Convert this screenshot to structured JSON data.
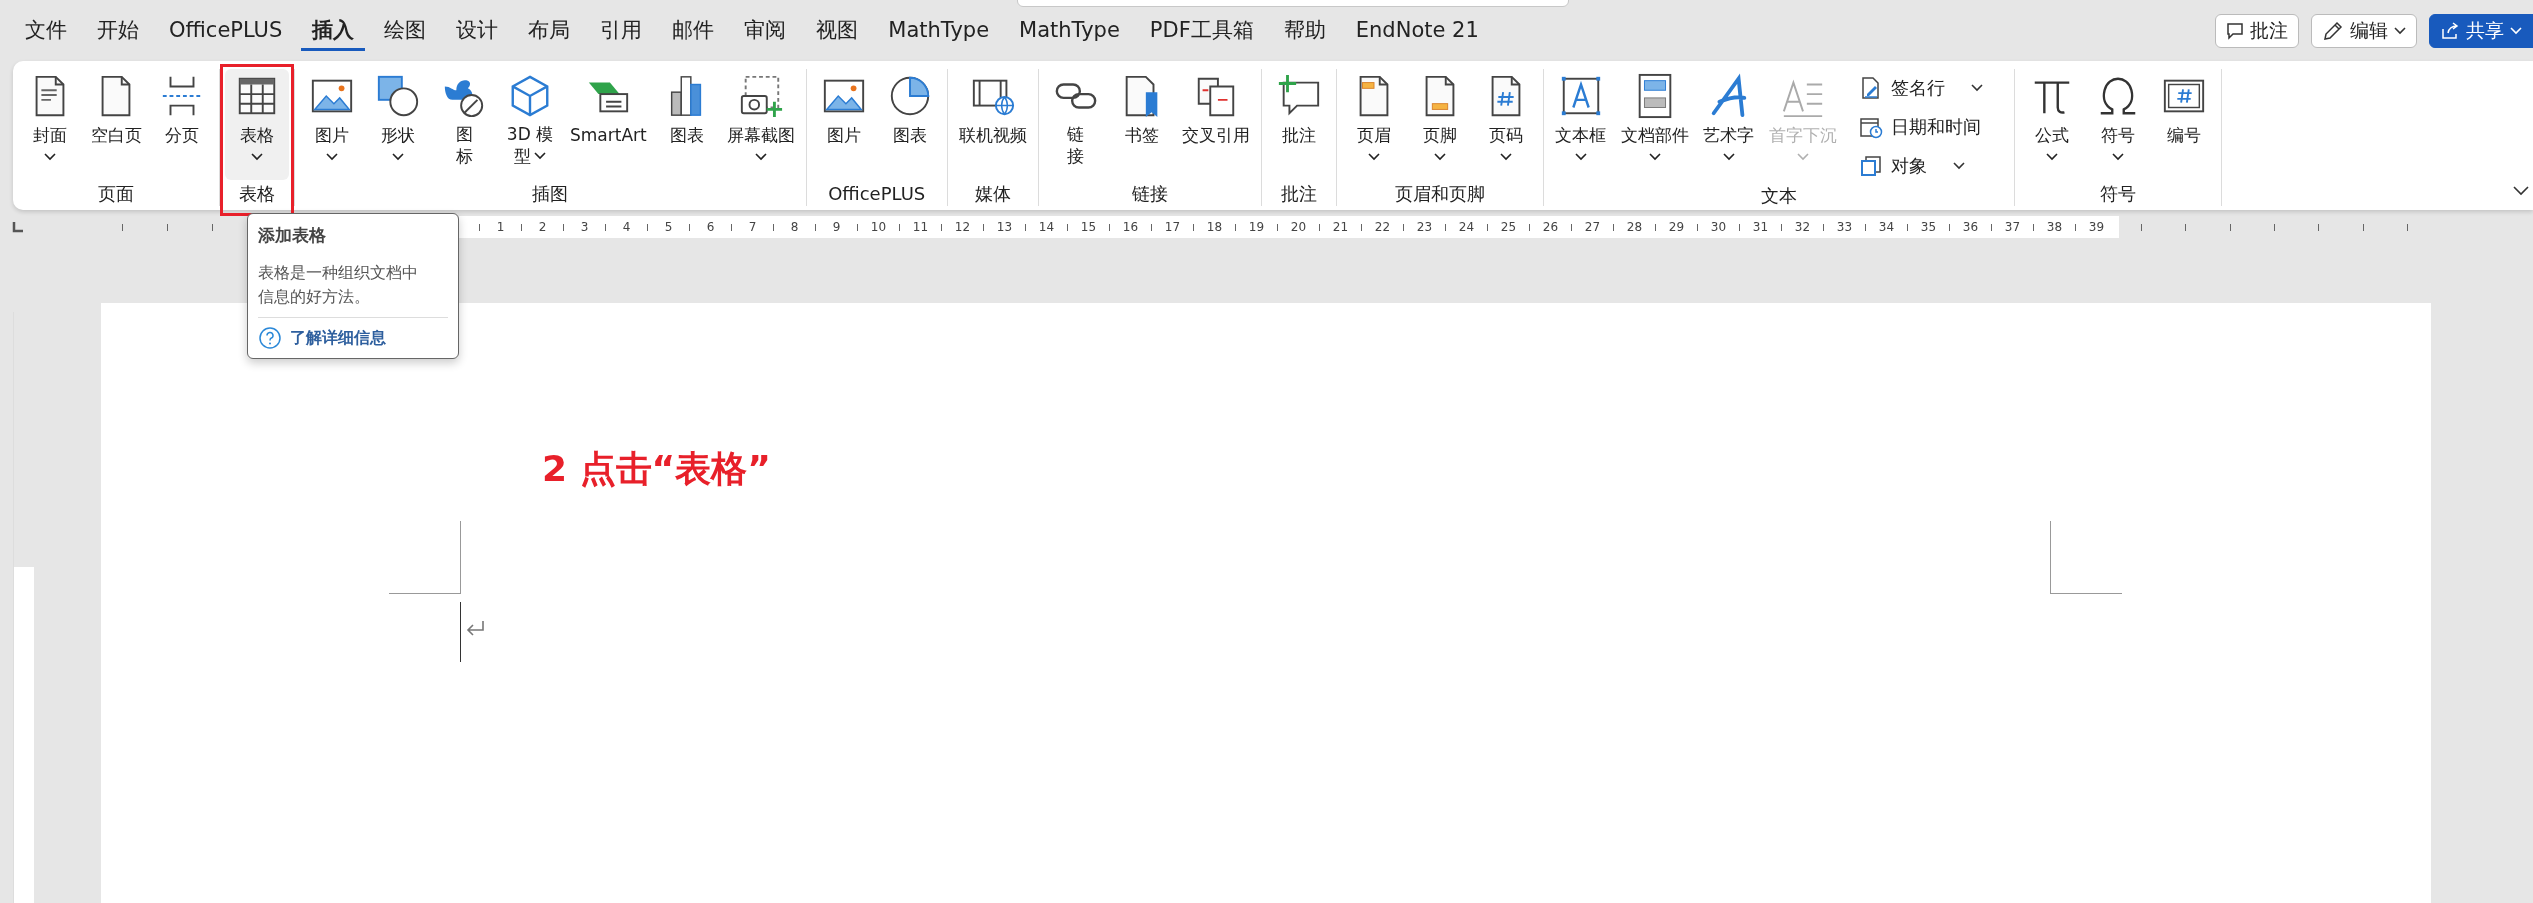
{
  "tabs": [
    {
      "label": "文件",
      "selected": false
    },
    {
      "label": "开始",
      "selected": false
    },
    {
      "label": "OfficePLUS",
      "selected": false
    },
    {
      "label": "插入",
      "selected": true
    },
    {
      "label": "绘图",
      "selected": false
    },
    {
      "label": "设计",
      "selected": false
    },
    {
      "label": "布局",
      "selected": false
    },
    {
      "label": "引用",
      "selected": false
    },
    {
      "label": "邮件",
      "selected": false
    },
    {
      "label": "审阅",
      "selected": false
    },
    {
      "label": "视图",
      "selected": false
    },
    {
      "label": "MathType",
      "selected": false
    },
    {
      "label": "MathType",
      "selected": false
    },
    {
      "label": "PDF工具箱",
      "selected": false
    },
    {
      "label": "帮助",
      "selected": false
    },
    {
      "label": "EndNote 21",
      "selected": false
    }
  ],
  "header_buttons": [
    {
      "label": "批注",
      "kind": "comment"
    },
    {
      "label": "编辑",
      "kind": "edit"
    },
    {
      "label": "共享",
      "kind": "share"
    }
  ],
  "ribbon_groups": [
    {
      "label": "页面",
      "highlighted": false,
      "items": [
        {
          "label": "封面",
          "kind": "large",
          "dropdown": true,
          "disabled": false
        },
        {
          "label": "空白页",
          "kind": "large",
          "dropdown": false,
          "disabled": false
        },
        {
          "label": "分页",
          "kind": "large",
          "dropdown": false,
          "disabled": false
        }
      ]
    },
    {
      "label": "表格",
      "highlighted": true,
      "items": [
        {
          "label": "表格",
          "kind": "large",
          "dropdown": true,
          "disabled": false
        }
      ]
    },
    {
      "label": "插图",
      "highlighted": false,
      "items": [
        {
          "label": "图片",
          "kind": "large",
          "dropdown": true,
          "disabled": false
        },
        {
          "label": "形状",
          "kind": "large",
          "dropdown": true,
          "disabled": false
        },
        {
          "label": "图标",
          "kind": "narrow",
          "dropdown": false,
          "disabled": false
        },
        {
          "label": "3D 模型",
          "kind": "wrapped",
          "dropdown": true,
          "disabled": false
        },
        {
          "label": "SmartArt",
          "kind": "large",
          "dropdown": false,
          "disabled": false
        },
        {
          "label": "图表",
          "kind": "large",
          "dropdown": false,
          "disabled": false
        },
        {
          "label": "屏幕截图",
          "kind": "large",
          "dropdown": true,
          "disabled": false
        }
      ]
    },
    {
      "label": "OfficePLUS",
      "highlighted": false,
      "items": [
        {
          "label": "图片",
          "kind": "large",
          "dropdown": false,
          "disabled": false
        },
        {
          "label": "图表",
          "kind": "large",
          "dropdown": false,
          "disabled": false
        }
      ]
    },
    {
      "label": "媒体",
      "highlighted": false,
      "items": [
        {
          "label": "联机视频",
          "kind": "large",
          "dropdown": false,
          "disabled": false
        }
      ]
    },
    {
      "label": "链接",
      "highlighted": false,
      "items": [
        {
          "label": "链接",
          "kind": "narrow",
          "dropdown": false,
          "disabled": false
        },
        {
          "label": "书签",
          "kind": "large",
          "dropdown": false,
          "disabled": false
        },
        {
          "label": "交叉引用",
          "kind": "large",
          "dropdown": false,
          "disabled": false
        }
      ]
    },
    {
      "label": "批注",
      "highlighted": false,
      "items": [
        {
          "label": "批注",
          "kind": "large",
          "dropdown": false,
          "disabled": false
        }
      ]
    },
    {
      "label": "页眉和页脚",
      "highlighted": false,
      "items": [
        {
          "label": "页眉",
          "kind": "large",
          "dropdown": true,
          "disabled": false
        },
        {
          "label": "页脚",
          "kind": "large",
          "dropdown": true,
          "disabled": false
        },
        {
          "label": "页码",
          "kind": "large",
          "dropdown": true,
          "disabled": false
        }
      ]
    },
    {
      "label": "文本",
      "highlighted": false,
      "items": [
        {
          "label": "文本框",
          "kind": "large",
          "dropdown": true,
          "disabled": false
        },
        {
          "label": "文档部件",
          "kind": "large",
          "dropdown": true,
          "disabled": false
        },
        {
          "label": "艺术字",
          "kind": "large",
          "dropdown": true,
          "disabled": false
        },
        {
          "label": "首字下沉",
          "kind": "large",
          "dropdown": true,
          "disabled": true
        }
      ],
      "stack": [
        {
          "label": "签名行",
          "dropdown": true
        },
        {
          "label": "日期和时间",
          "dropdown": false
        },
        {
          "label": "对象",
          "dropdown": true
        }
      ]
    },
    {
      "label": "符号",
      "highlighted": false,
      "items": [
        {
          "label": "公式",
          "kind": "large",
          "dropdown": true,
          "disabled": false
        },
        {
          "label": "符号",
          "kind": "large",
          "dropdown": true,
          "disabled": false
        },
        {
          "label": "编号",
          "kind": "large",
          "dropdown": false,
          "disabled": false
        }
      ]
    }
  ],
  "ruler": {
    "numbers": [
      "1",
      "2",
      "3",
      "4",
      "5",
      "6",
      "7",
      "8",
      "9",
      "10",
      "11",
      "12",
      "13",
      "14",
      "15",
      "16",
      "17",
      "18",
      "19",
      "20",
      "21",
      "22",
      "23",
      "24",
      "25",
      "26",
      "27",
      "28",
      "29",
      "30",
      "31",
      "32",
      "33",
      "34",
      "35",
      "36",
      "37",
      "38",
      "39"
    ]
  },
  "tooltip": {
    "title": "添加表格",
    "body": "表格是一种组织文档中信息的好方法。",
    "link": "了解详细信息"
  },
  "document": {
    "annotation": "2 点击“表格”"
  }
}
